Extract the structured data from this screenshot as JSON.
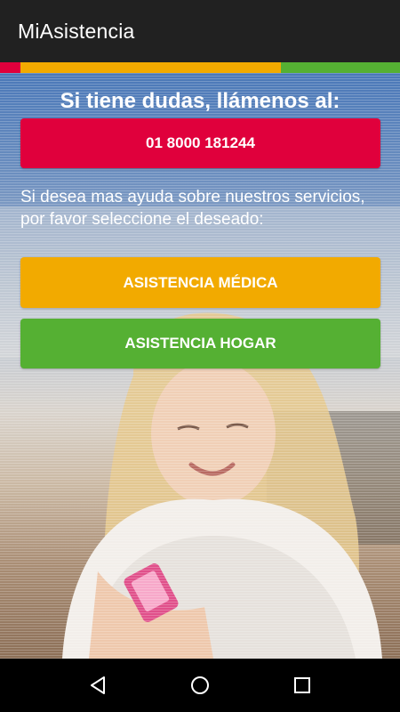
{
  "app": {
    "title": "MiAsistencia"
  },
  "colors": {
    "red": "#E0003C",
    "yellow": "#F2AA00",
    "green": "#55B033",
    "app_bar": "#212121"
  },
  "main": {
    "heading": "Si tiene dudas, llámenos al:",
    "phone_button": "01 8000 181244",
    "info_text": "Si desea mas ayuda sobre nuestros servicios, por favor seleccione el deseado:",
    "medical_button": "ASISTENCIA MÉDICA",
    "home_button": "ASISTENCIA HOGAR"
  },
  "nav": {
    "back": "back-icon",
    "home": "home-icon",
    "recents": "recents-icon"
  }
}
